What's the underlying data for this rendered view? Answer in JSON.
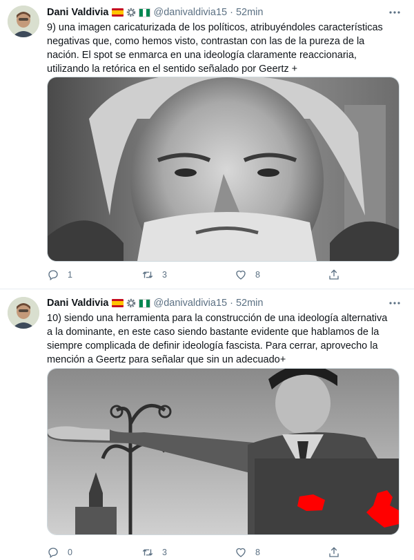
{
  "tweets": [
    {
      "author": {
        "name": "Dani Valdivia",
        "handle": "@danivaldivia15"
      },
      "separator": "·",
      "time": "52min",
      "text": "9) una imagen caricaturizada de los políticos, atribuyéndoles características negativas que, como hemos visto, contrastan con las de la pureza de la nación. El spot se enmarca en una ideología claramente reaccionaria, utilizando la retórica en el sentido señalado por Geertz +",
      "media": {
        "image": "portrait-elderly-bearded-man-bw"
      },
      "counts": {
        "replies": "1",
        "retweets": "3",
        "likes": "8"
      }
    },
    {
      "author": {
        "name": "Dani Valdivia",
        "handle": "@danivaldivia15"
      },
      "separator": "·",
      "time": "52min",
      "text": "10) siendo una herramienta para la construcción de una ideología alternativa a la dominante, en este caso siendo bastante evidente que hablamos de la siempre complicada de definir ideología fascista. Para cerrar, aprovecho la mención a Geertz para señalar que sin un adecuado+",
      "media": {
        "image": "historical-photo-saluting-man-bw-redacted"
      },
      "counts": {
        "replies": "0",
        "retweets": "3",
        "likes": "8"
      }
    }
  ],
  "icons": {
    "reply": "reply-icon",
    "retweet": "retweet-icon",
    "like": "heart-icon",
    "share": "share-icon",
    "more": "more-icon",
    "verified_flags": [
      "spain-flag-icon",
      "gear-icon",
      "nigeria-flag-icon"
    ]
  },
  "colors": {
    "text": "#0f1419",
    "muted": "#5b7083",
    "border": "#e6ecf0",
    "redaction": "#ff0000"
  }
}
